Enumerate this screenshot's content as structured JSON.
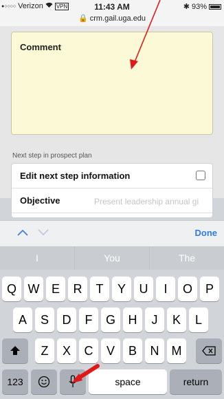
{
  "status_bar": {
    "carrier": "Verizon",
    "vpn_label": "VPN",
    "time": "11:43 AM",
    "url": "crm.gail.uga.edu",
    "battery": "93%"
  },
  "form": {
    "comment_label": "Comment",
    "section_label": "Next step in prospect plan",
    "edit_next_step_label": "Edit next step information",
    "objective_label": "Objective",
    "objective_value": "Present leadership annual gi"
  },
  "toolbar": {
    "done_label": "Done"
  },
  "keyboard": {
    "suggestions": [
      "I",
      "You",
      "The"
    ],
    "row1": [
      "Q",
      "W",
      "E",
      "R",
      "T",
      "Y",
      "U",
      "I",
      "O",
      "P"
    ],
    "row2": [
      "A",
      "S",
      "D",
      "F",
      "G",
      "H",
      "J",
      "K",
      "L"
    ],
    "row3": [
      "Z",
      "X",
      "C",
      "V",
      "B",
      "N",
      "M"
    ],
    "numbers_label": "123",
    "space_label": "space",
    "return_label": "return"
  },
  "colors": {
    "accent": "#2f7be0",
    "annotation_arrow": "#e01818",
    "comment_bg": "#fbf9d6"
  }
}
